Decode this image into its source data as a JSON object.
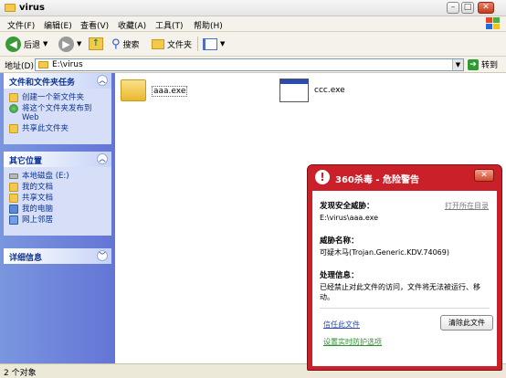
{
  "window": {
    "title": "virus"
  },
  "menu": [
    "文件(F)",
    "编辑(E)",
    "查看(V)",
    "收藏(A)",
    "工具(T)",
    "帮助(H)"
  ],
  "toolbar": {
    "back": "后退",
    "search": "搜索",
    "folders": "文件夹"
  },
  "address": {
    "label": "地址(D)",
    "path": "E:\\virus",
    "go": "转到"
  },
  "taskpane": {
    "file_tasks": {
      "title": "文件和文件夹任务",
      "items": [
        "创建一个新文件夹",
        "将这个文件夹发布到 Web",
        "共享此文件夹"
      ]
    },
    "other_places": {
      "title": "其它位置",
      "items": [
        "本地磁盘 (E:)",
        "我的文档",
        "共享文档",
        "我的电脑",
        "网上邻居"
      ]
    },
    "details": {
      "title": "详细信息"
    }
  },
  "files": [
    {
      "name": "aaa.exe",
      "icon": "folder-icon"
    },
    {
      "name": "ccc.exe",
      "icon": "window-app-icon"
    }
  ],
  "status": {
    "text": "2 个对象"
  },
  "popup": {
    "title": "360杀毒 - 危险警告",
    "threat_heading": "发现安全威胁：",
    "open_location": "打开所在目录",
    "path": "E:\\virus\\aaa.exe",
    "name_heading": "威胁名称：",
    "name_value": "可疑木马(Trojan.Generic.KDV.74069)",
    "action_heading": "处理信息：",
    "action_text": "已经禁止对此文件的访问，文件将无法被运行、移动。",
    "trust_link": "信任此文件",
    "remove_button": "清除此文件",
    "settings_link": "设置实时防护选项"
  },
  "colors": {
    "popup_red": "#c9202a",
    "taskpane_blue": "#6375d6",
    "link_green": "#2f8f2f"
  }
}
